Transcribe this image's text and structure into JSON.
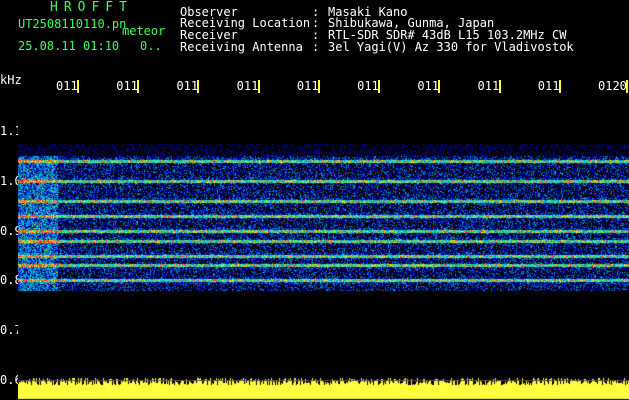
{
  "header": {
    "app_title": "HROFFT",
    "file_name": "UT2508110110.pn",
    "meteor_label": "meteor",
    "timestamp": "25.08.11 01:10",
    "count": "0.."
  },
  "info": [
    {
      "key": "Observer",
      "value": "Masaki Kano"
    },
    {
      "key": "Receiving Location",
      "value": "Shibukawa, Gunma, Japan"
    },
    {
      "key": "Receiver",
      "value": "RTL-SDR SDR# 43dB L15 103.2MHz CW"
    },
    {
      "key": "Receiving Antenna",
      "value": "3el Yagi(V) Az 330 for Vladivostok"
    }
  ],
  "axis": {
    "unit": "kHz",
    "time_ticks": [
      "011",
      "011",
      "011",
      "011",
      "011",
      "011",
      "011",
      "011",
      "011",
      "0120"
    ],
    "freq_ticks": [
      "1.1",
      "1.0",
      "0.9",
      "0.8",
      "0.7",
      "0.6"
    ]
  },
  "colors": {
    "header_green": "#3cff5a",
    "tick_yellow": "#ffff3c",
    "text_white": "#ffffff",
    "background": "#000000"
  },
  "chart_data": {
    "type": "heatmap",
    "xlabel": "",
    "ylabel": "kHz",
    "y_range": [
      0.6,
      1.15
    ],
    "ticks_y": [
      1.1,
      1.0,
      0.9,
      0.8,
      0.7,
      0.6
    ],
    "ticks_x": [
      "011",
      "011",
      "011",
      "011",
      "011",
      "011",
      "011",
      "011",
      "011",
      "0120"
    ],
    "signal_bands_khz": [
      0.8,
      0.83,
      0.85,
      0.88,
      0.9,
      0.93,
      0.96,
      1.0,
      1.04
    ]
  }
}
